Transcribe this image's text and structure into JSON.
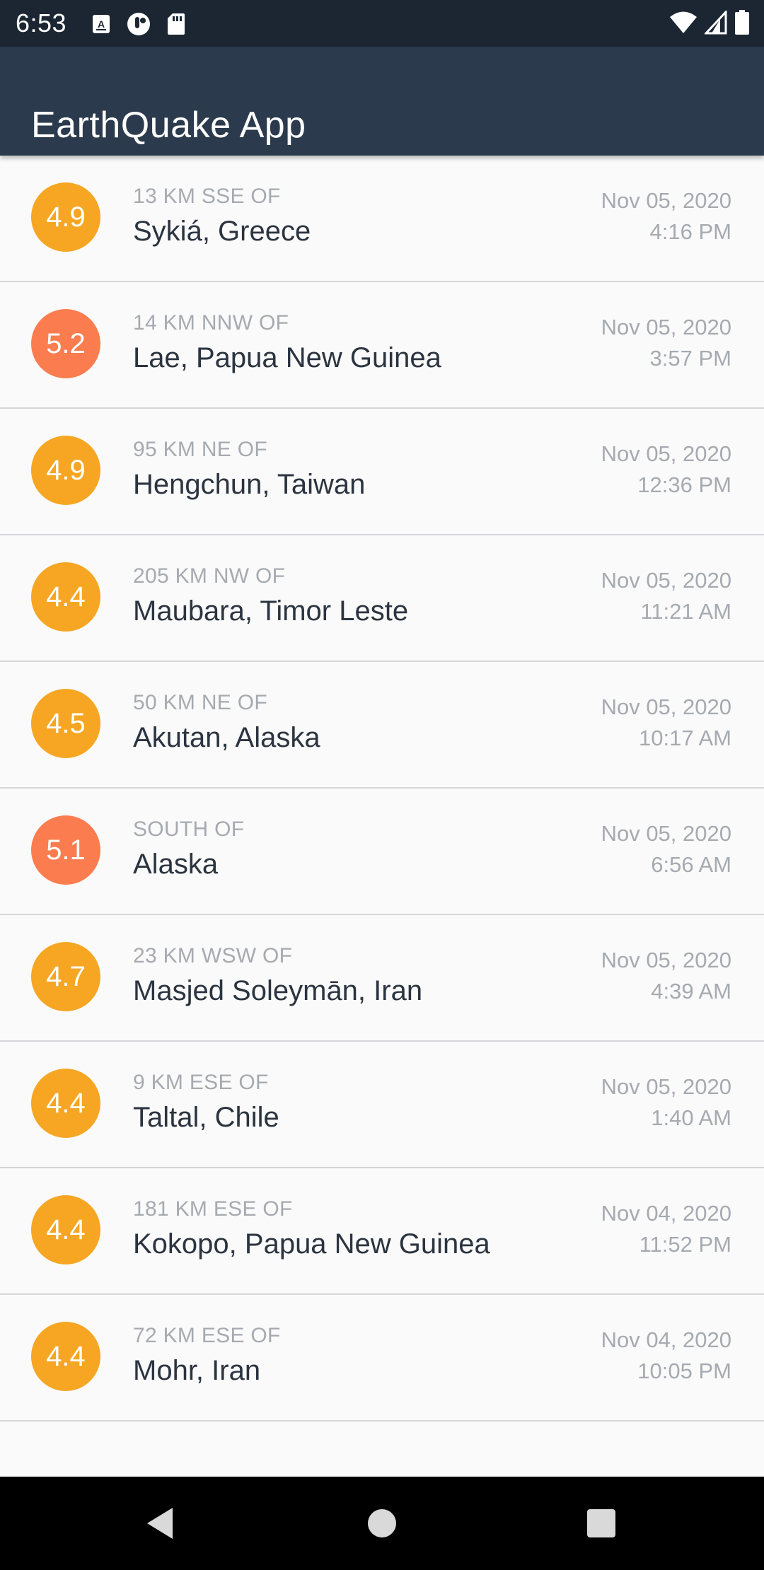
{
  "status_bar": {
    "time": "6:53",
    "icons_left": [
      "keyboard-a-icon",
      "podcast-icon",
      "sd-card-icon"
    ],
    "icons_right": [
      "wifi-icon",
      "cell-signal-icon",
      "battery-icon"
    ]
  },
  "app_bar": {
    "title": "EarthQuake App"
  },
  "colors": {
    "status_bar": "#1c2633",
    "app_bar": "#2c3a4d",
    "mag_orange": "#f6a623",
    "mag_red": "#fb7d4f",
    "offset_text": "#a6aab0",
    "place_text": "#2b3440"
  },
  "earthquakes": [
    {
      "magnitude": "4.9",
      "offset": "13 KM SSE OF",
      "place": "Sykiá, Greece",
      "date": "Nov 05, 2020",
      "time": "4:16 PM",
      "color": "#f6a623"
    },
    {
      "magnitude": "5.2",
      "offset": "14 KM NNW OF",
      "place": "Lae, Papua New Guinea",
      "date": "Nov 05, 2020",
      "time": "3:57 PM",
      "color": "#fb7d4f"
    },
    {
      "magnitude": "4.9",
      "offset": "95 KM NE OF",
      "place": "Hengchun, Taiwan",
      "date": "Nov 05, 2020",
      "time": "12:36 PM",
      "color": "#f6a623"
    },
    {
      "magnitude": "4.4",
      "offset": "205 KM NW OF",
      "place": "Maubara, Timor Leste",
      "date": "Nov 05, 2020",
      "time": "11:21 AM",
      "color": "#f6a623"
    },
    {
      "magnitude": "4.5",
      "offset": "50 KM NE OF",
      "place": "Akutan, Alaska",
      "date": "Nov 05, 2020",
      "time": "10:17 AM",
      "color": "#f6a623"
    },
    {
      "magnitude": "5.1",
      "offset": "SOUTH OF",
      "place": "Alaska",
      "date": "Nov 05, 2020",
      "time": "6:56 AM",
      "color": "#fb7d4f"
    },
    {
      "magnitude": "4.7",
      "offset": "23 KM WSW OF",
      "place": "Masjed Soleymān, Iran",
      "date": "Nov 05, 2020",
      "time": "4:39 AM",
      "color": "#f6a623"
    },
    {
      "magnitude": "4.4",
      "offset": "9 KM ESE OF",
      "place": "Taltal, Chile",
      "date": "Nov 05, 2020",
      "time": "1:40 AM",
      "color": "#f6a623"
    },
    {
      "magnitude": "4.4",
      "offset": "181 KM ESE OF",
      "place": "Kokopo, Papua New Guinea",
      "date": "Nov 04, 2020",
      "time": "11:52 PM",
      "color": "#f6a623"
    },
    {
      "magnitude": "4.4",
      "offset": "72 KM ESE OF",
      "place": "Mohr, Iran",
      "date": "Nov 04, 2020",
      "time": "10:05 PM",
      "color": "#f6a623"
    }
  ],
  "nav_bar": {
    "buttons": [
      "back-icon",
      "home-icon",
      "recents-icon"
    ]
  }
}
